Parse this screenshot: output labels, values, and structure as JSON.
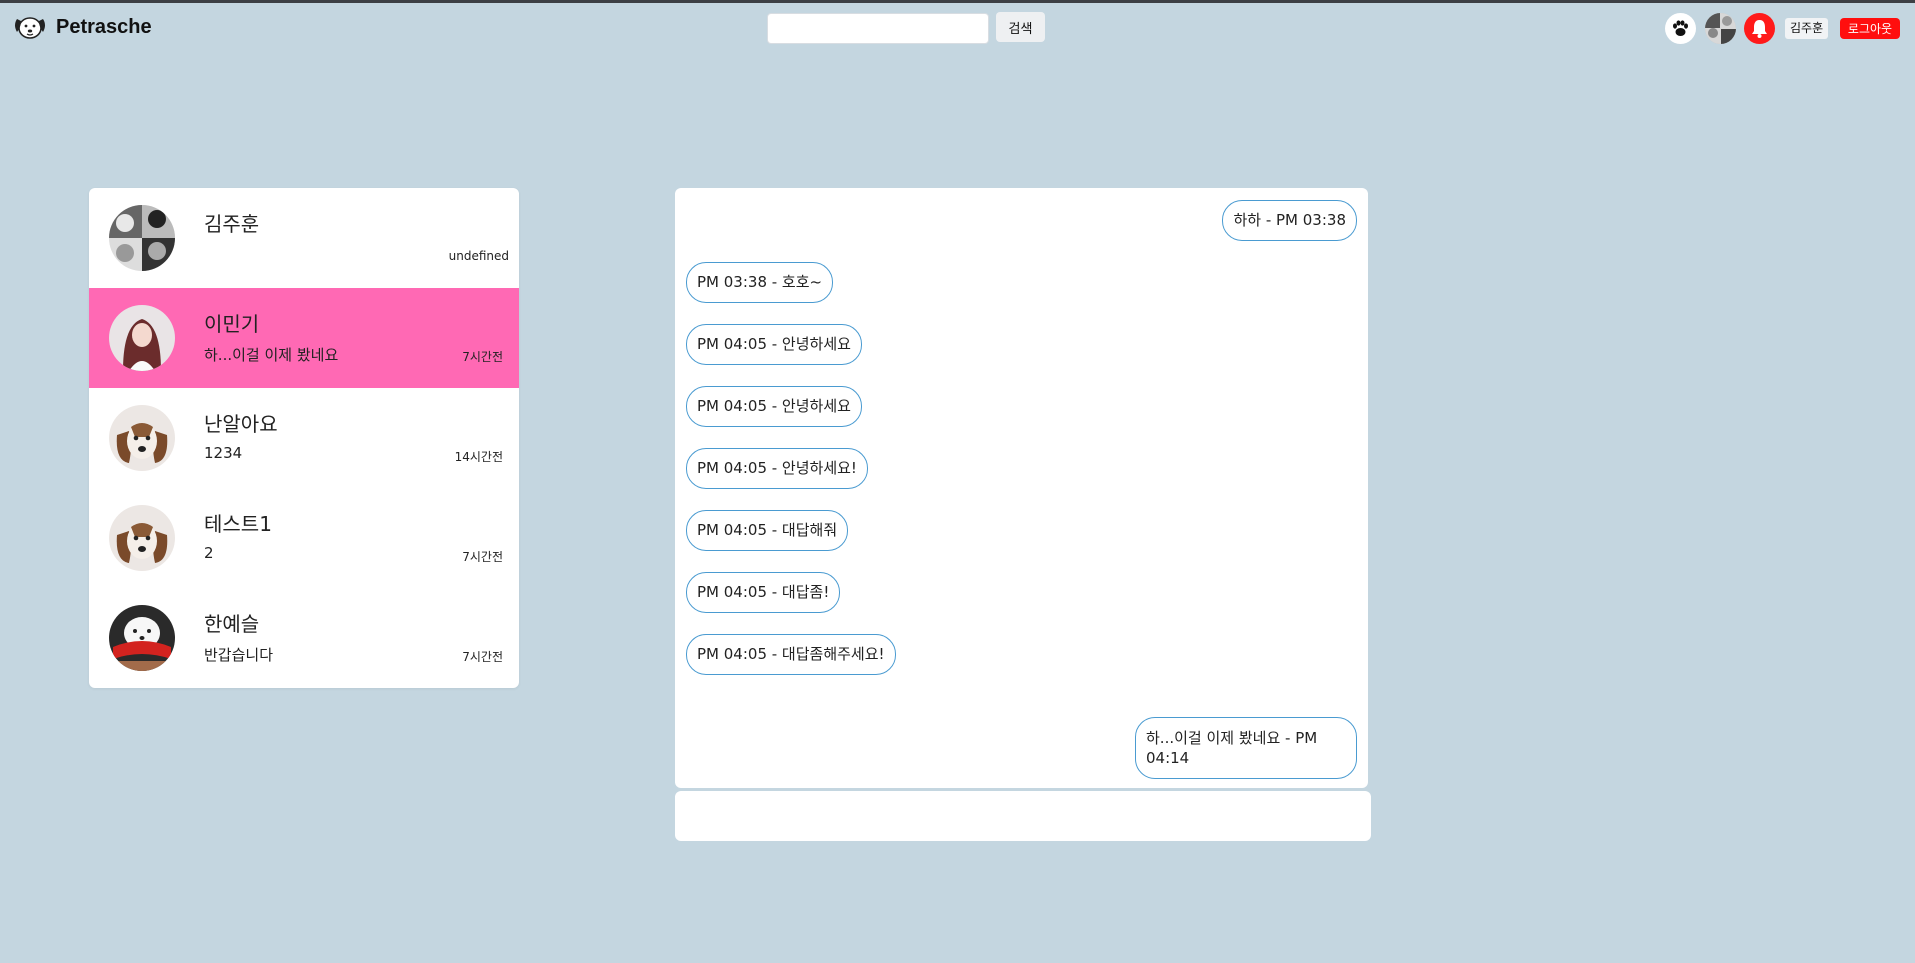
{
  "app": {
    "brand": "Petrasche",
    "logo_icon": "dog-face-icon"
  },
  "header": {
    "search": {
      "value": "",
      "placeholder": "",
      "button_label": "검색"
    },
    "icons": [
      "paw-icon",
      "user-avatar-icon",
      "bell-icon"
    ],
    "username": "김주훈",
    "logout_label": "로그아웃",
    "colors": {
      "bell": "#ff1a1a",
      "logout": "#ff0e0e"
    }
  },
  "rooms": [
    {
      "name": "김주훈",
      "preview": "",
      "time": "undefined",
      "avatar": "group-photo-avatar",
      "active": false
    },
    {
      "name": "이민기",
      "preview": "하...이걸 이제 봤네요",
      "time": "7시간전",
      "avatar": "woman-portrait-avatar",
      "active": true
    },
    {
      "name": "난알아요",
      "preview": "1234",
      "time": "14시간전",
      "avatar": "beagle-puppy-avatar",
      "active": false
    },
    {
      "name": "테스트1",
      "preview": "2",
      "time": "7시간전",
      "avatar": "beagle-puppy-avatar",
      "active": false
    },
    {
      "name": "한예슬",
      "preview": "반갑습니다",
      "time": "7시간전",
      "avatar": "white-dog-red-scarf-avatar",
      "active": false
    }
  ],
  "active_color": "#ff69b4",
  "messages": [
    {
      "text": "하하 - PM 03:38",
      "side": "right"
    },
    {
      "text": "PM 03:38 - 호호~",
      "side": "left"
    },
    {
      "text": "PM 04:05 - 안녕하세요",
      "side": "left"
    },
    {
      "text": "PM 04:05 - 안녕하세요",
      "side": "left"
    },
    {
      "text": "PM 04:05 - 안녕하세요!",
      "side": "left"
    },
    {
      "text": "PM 04:05 - 대답해줘",
      "side": "left"
    },
    {
      "text": "PM 04:05 - 대답좀!",
      "side": "left"
    },
    {
      "text": "PM 04:05 - 대답좀해주세요!",
      "side": "left"
    },
    {
      "text": "하...이걸 이제 봤네요 - PM 04:14",
      "side": "right"
    }
  ],
  "chat_input": {
    "value": "",
    "placeholder": ""
  }
}
